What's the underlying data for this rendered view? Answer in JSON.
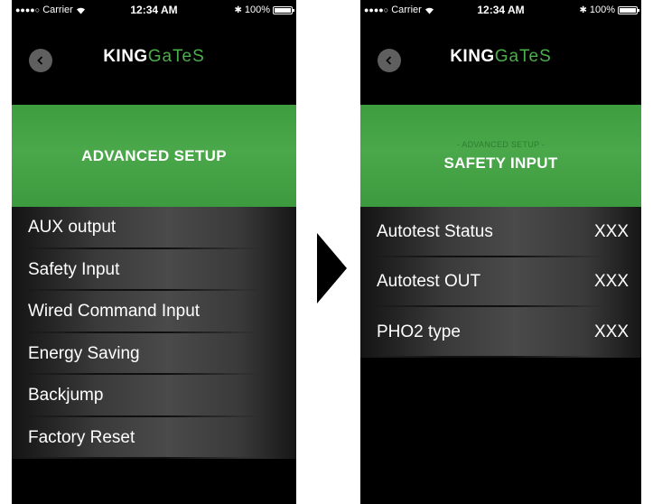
{
  "status_bar": {
    "carrier": "Carrier",
    "time": "12:34 AM",
    "battery": "100%"
  },
  "brand": {
    "king": "KING",
    "gates": "GaTeS",
    "accent_color": "#4caf4a"
  },
  "left_screen": {
    "banner_title": "ADVANCED SETUP",
    "menu_items": [
      {
        "label": "AUX output"
      },
      {
        "label": "Safety Input"
      },
      {
        "label": "Wired Command Input"
      },
      {
        "label": "Energy Saving"
      },
      {
        "label": "Backjump"
      },
      {
        "label": "Factory Reset"
      }
    ]
  },
  "right_screen": {
    "banner_subtitle": "- ADVANCED SETUP -",
    "banner_title": "SAFETY INPUT",
    "rows": [
      {
        "label": "Autotest Status",
        "value": "XXX"
      },
      {
        "label": "Autotest OUT",
        "value": "XXX"
      },
      {
        "label": "PHO2 type",
        "value": "XXX"
      }
    ]
  },
  "icons": {
    "back": "chevron-left-icon",
    "wifi": "wifi-icon",
    "bluetooth": "bluetooth-icon",
    "battery": "battery-icon",
    "transition": "arrow-right-icon"
  }
}
